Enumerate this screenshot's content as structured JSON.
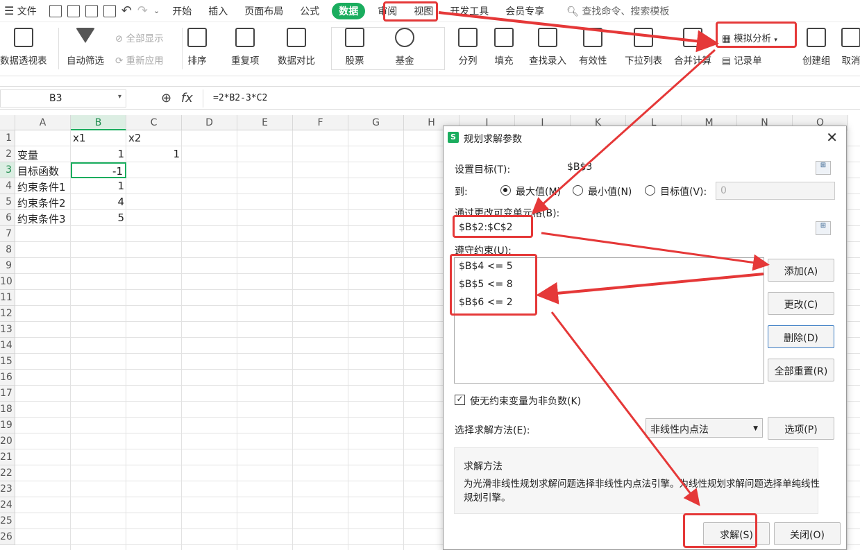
{
  "menubar": {
    "hamburger_label": "文件",
    "tabs": [
      "开始",
      "插入",
      "页面布局",
      "公式",
      "数据",
      "审阅",
      "视图",
      "开发工具",
      "会员专享"
    ],
    "active_tab": "数据",
    "search_placeholder": "查找命令、搜索模板"
  },
  "ribbon": {
    "pivot": "数据透视表",
    "autofilter": "自动筛选",
    "show_all": "全部显示",
    "reapply": "重新应用",
    "sort": "排序",
    "duplicates": "重复项",
    "compare": "数据对比",
    "stocks": "股票",
    "funds": "基金",
    "split": "分列",
    "fill": "填充",
    "lookup_entry": "查找录入",
    "validity": "有效性",
    "dropdown_list": "下拉列表",
    "merge_calc": "合并计算",
    "what_if": "模拟分析",
    "record": "记录单",
    "create_group": "创建组",
    "ungroup": "取消"
  },
  "formula_bar": {
    "cell_ref": "B3",
    "formula": "=2*B2-3*C2"
  },
  "sheet": {
    "columns": [
      "A",
      "B",
      "C",
      "D",
      "E",
      "F",
      "G",
      "H",
      "I",
      "J",
      "K",
      "L",
      "M",
      "N",
      "O"
    ],
    "rows": [
      "1",
      "2",
      "3",
      "4",
      "5",
      "6",
      "7",
      "8",
      "9",
      "10",
      "11",
      "12",
      "13",
      "14",
      "15",
      "16",
      "17",
      "18",
      "19",
      "20",
      "21",
      "22",
      "23",
      "24",
      "25",
      "26"
    ],
    "cells": {
      "B1": "x1",
      "C1": "x2",
      "A2": "变量",
      "B2": "1",
      "C2": "1",
      "A3": "目标函数",
      "B3": "-1",
      "A4": "约束条件1",
      "B4": "1",
      "A5": "约束条件2",
      "B5": "4",
      "A6": "约束条件3",
      "B6": "5"
    }
  },
  "dialog": {
    "logo": "S",
    "title": "规划求解参数",
    "set_objective_label": "设置目标(T):",
    "objective_value": "$B$3",
    "to_label": "到:",
    "opt_max": "最大值(M)",
    "opt_min": "最小值(N)",
    "opt_value": "目标值(V):",
    "target_value": "0",
    "changing_cells_label": "通过更改可变单元格(B):",
    "changing_cells_value": "$B$2:$C$2",
    "constraints_label": "遵守约束(U):",
    "constraints": [
      "$B$4 <= 5",
      "$B$5 <= 8",
      "$B$6 <= 2"
    ],
    "btn_add": "添加(A)",
    "btn_change": "更改(C)",
    "btn_delete": "删除(D)",
    "btn_reset": "全部重置(R)",
    "nonneg_label": "使无约束变量为非负数(K)",
    "method_label": "选择求解方法(E):",
    "method_value": "非线性内点法",
    "btn_options": "选项(P)",
    "method_heading": "求解方法",
    "method_text": "为光滑非线性规划求解问题选择非线性内点法引擎。为线性规划求解问题选择单纯线性规划引擎。",
    "btn_solve": "求解(S)",
    "btn_close": "关闭(O)"
  },
  "colors": {
    "accent_green": "#1aad5e",
    "annotation_red": "#e53838"
  }
}
